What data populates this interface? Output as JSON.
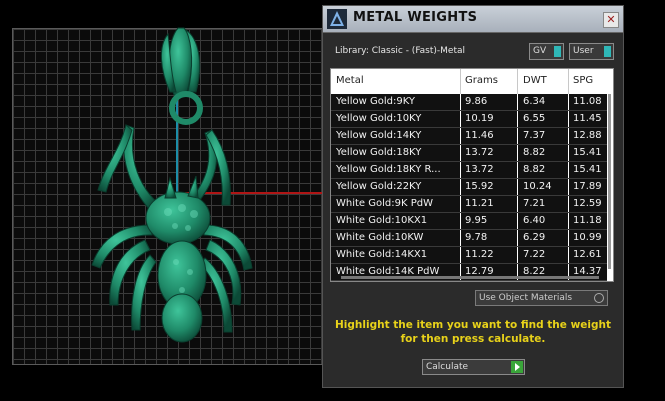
{
  "panel": {
    "title": "METAL WEIGHTS",
    "close_glyph": "✕",
    "library_label": "Library: Classic - (Fast)-Metal",
    "toggle_gv": "GV",
    "toggle_user": "User",
    "columns": [
      "Metal",
      "Grams",
      "DWT",
      "SPG"
    ],
    "rows": [
      [
        "Yellow Gold:9KY",
        "9.86",
        "6.34",
        "11.08"
      ],
      [
        "Yellow Gold:10KY",
        "10.19",
        "6.55",
        "11.45"
      ],
      [
        "Yellow Gold:14KY",
        "11.46",
        "7.37",
        "12.88"
      ],
      [
        "Yellow Gold:18KY",
        "13.72",
        "8.82",
        "15.41"
      ],
      [
        "Yellow Gold:18KY R...",
        "13.72",
        "8.82",
        "15.41"
      ],
      [
        "Yellow Gold:22KY",
        "15.92",
        "10.24",
        "17.89"
      ],
      [
        "White Gold:9K PdW",
        "11.21",
        "7.21",
        "12.59"
      ],
      [
        "White Gold:10KX1",
        "9.95",
        "6.40",
        "11.18"
      ],
      [
        "White Gold:10KW",
        "9.78",
        "6.29",
        "10.99"
      ],
      [
        "White Gold:14KX1",
        "11.22",
        "7.22",
        "12.61"
      ],
      [
        "White Gold:14K PdW",
        "12.79",
        "8.22",
        "14.37"
      ]
    ],
    "object_materials": "Use Object Materials",
    "hint": "Highlight the item you want to find the weight for then press calculate.",
    "calculate": "Calculate"
  },
  "colors": {
    "model": "#1f8a68",
    "hint": "#e8d21a",
    "toggle_knob": "#2fb8b8",
    "go_arrow": "#3aa53a"
  },
  "icons": {
    "title_logo": "app-logo-icon",
    "close": "close-icon",
    "go": "play-arrow-icon"
  }
}
